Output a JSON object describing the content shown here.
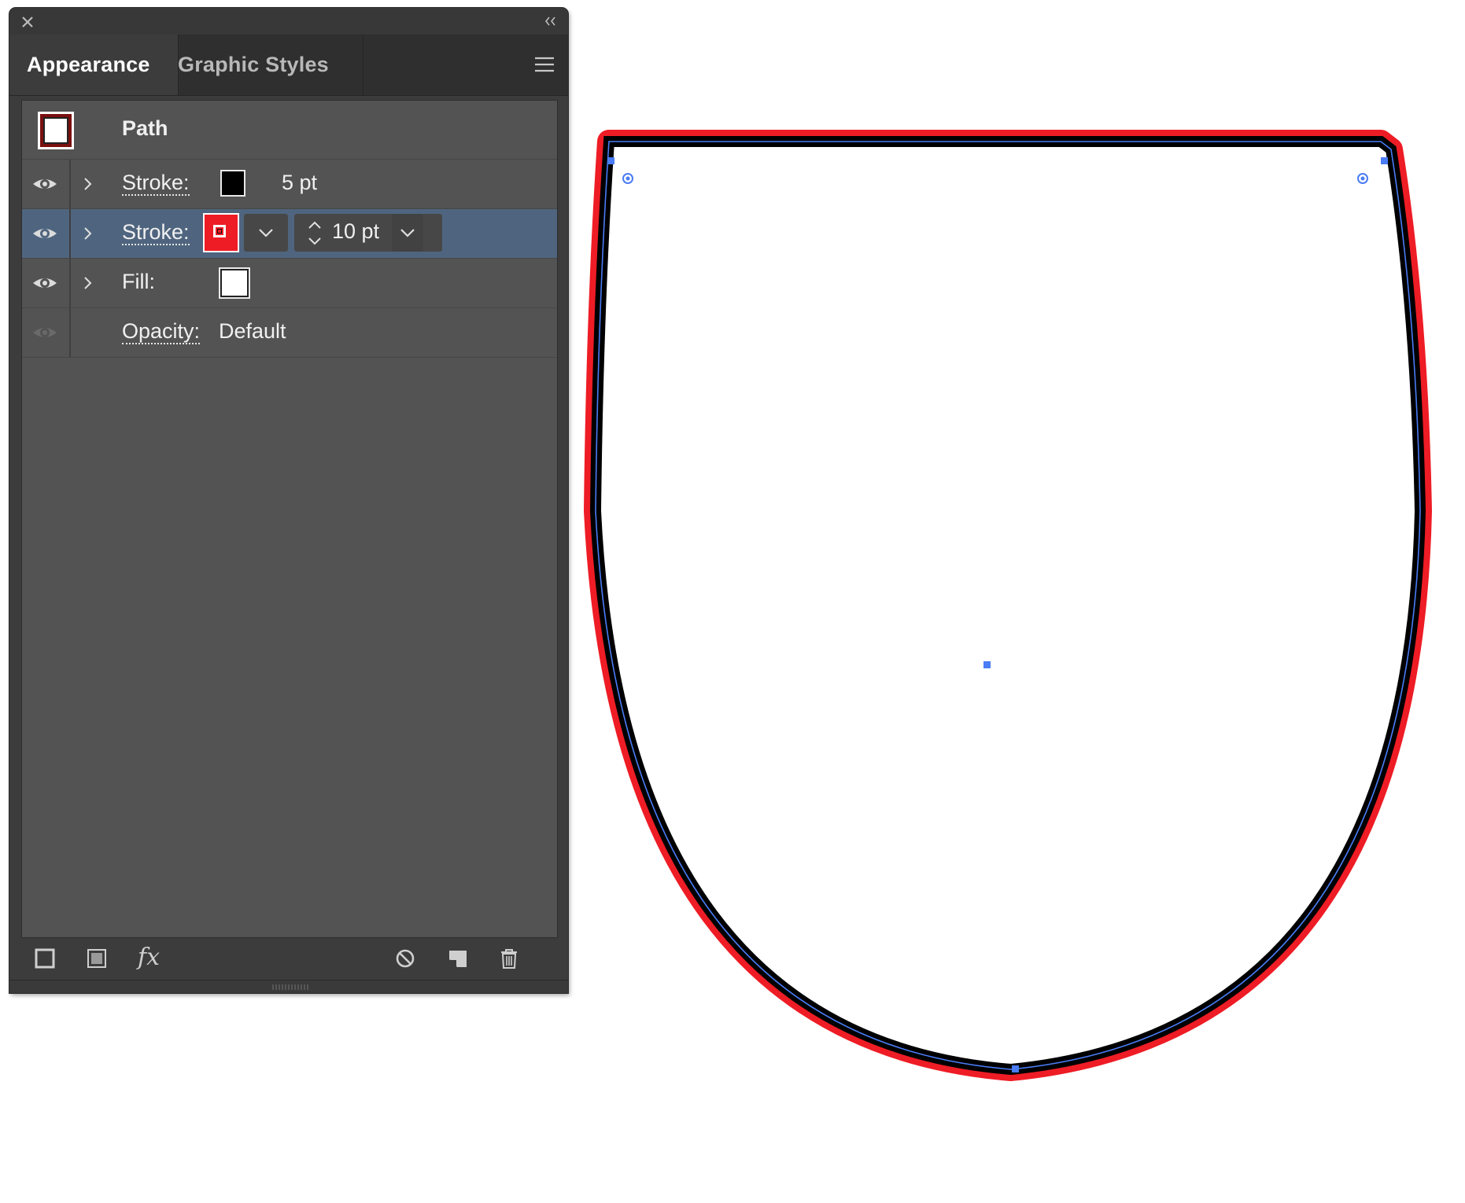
{
  "panel": {
    "tabs": [
      {
        "label": "Appearance",
        "active": true
      },
      {
        "label": "Graphic Styles",
        "active": false
      }
    ],
    "icons": {
      "close": "close-icon",
      "collapse": "collapse-double-chevron-icon",
      "menu": "hamburger-menu-icon"
    },
    "header": {
      "label": "Path",
      "swatch_icon": "stroke-fill-swatch-icon"
    },
    "rows": [
      {
        "label": "Stroke:",
        "swatch_color": "#000000",
        "value": "5 pt",
        "visible": true
      },
      {
        "label": "Stroke:",
        "swatch_color": "#ee1c25",
        "value": "10 pt",
        "visible": true,
        "selected": true
      },
      {
        "label": "Fill:",
        "swatch_color": "#ffffff",
        "visible": true
      },
      {
        "label": "Opacity:",
        "value": "Default",
        "visible": false
      }
    ],
    "footer_icons": [
      "add-new-stroke-icon",
      "add-new-fill-icon",
      "fx-effects-icon",
      "clear-appearance-icon",
      "duplicate-item-icon",
      "delete-trash-icon"
    ],
    "fx_label": "fx"
  },
  "canvas": {
    "object": "shield-path",
    "outer_stroke_color": "#ee1c25",
    "inner_stroke_color": "#000000",
    "fill_color": "#ffffff",
    "selection_color": "#4a7cf5"
  }
}
